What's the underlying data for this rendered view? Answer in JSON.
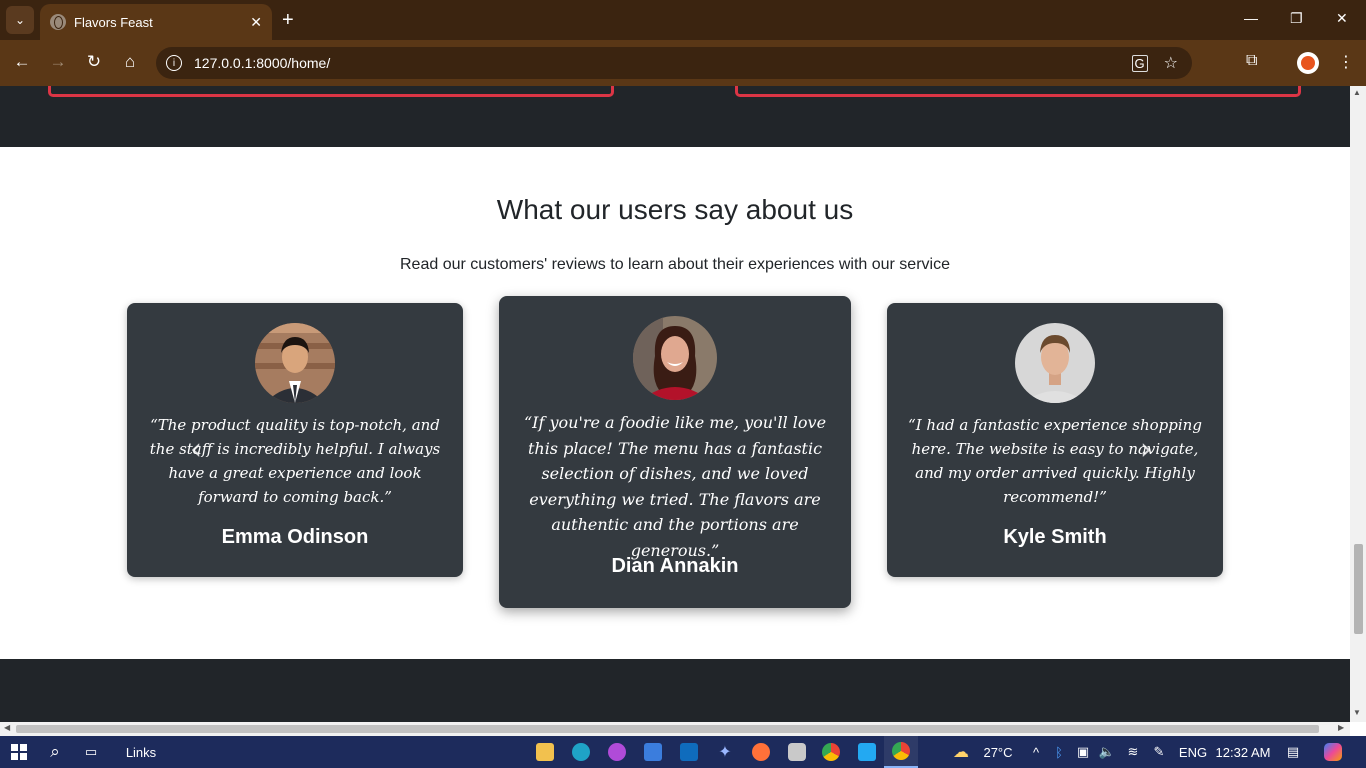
{
  "browser": {
    "tab_title": "Flavors Feast",
    "url": "127.0.0.1:8000/home/"
  },
  "section": {
    "heading": "What our users say about us",
    "subheading": "Read our customers' reviews to learn about their experiences with our service"
  },
  "testimonials": [
    {
      "quote": "“The product quality is top-notch, and the staff is incredibly helpful. I always have a great experience and look forward to coming back.”",
      "name": "Emma Odinson",
      "avatar_colors": {
        "bg": "#a67c60",
        "skin": "#d9a57c",
        "hair": "#1c1410",
        "suit": "#2b2f36",
        "shirt": "#ffffff"
      }
    },
    {
      "quote": "“If you're a foodie like me, you'll love this place! The menu has a fantastic selection of dishes, and we loved everything we tried. The flavors are authentic and the portions are generous.”",
      "name": "Dian Annakin",
      "avatar_colors": {
        "bg": "#8a7a6a",
        "skin": "#e0a890",
        "hair": "#3a1c14",
        "suit": "#b3122a",
        "shirt": "#b3122a"
      }
    },
    {
      "quote": "“I had a fantastic experience shopping here. The website is easy to navigate, and my order arrived quickly. Highly recommend!”",
      "name": "Kyle Smith",
      "avatar_colors": {
        "bg": "#d7d7d7",
        "skin": "#e2b497",
        "hair": "#6b4a2e",
        "suit": "#e0e0e0",
        "shirt": "#e0e0e0"
      }
    }
  ],
  "carousel": {
    "prev_icon": "chevron-left-icon",
    "next_icon": "chevron-right-icon"
  },
  "taskbar": {
    "links_label": "Links",
    "temperature": "27°C",
    "language": "ENG",
    "time": "12:32 AM"
  },
  "colors": {
    "dark": "#212529",
    "card": "#343a40",
    "accent_red": "#dc3545"
  }
}
